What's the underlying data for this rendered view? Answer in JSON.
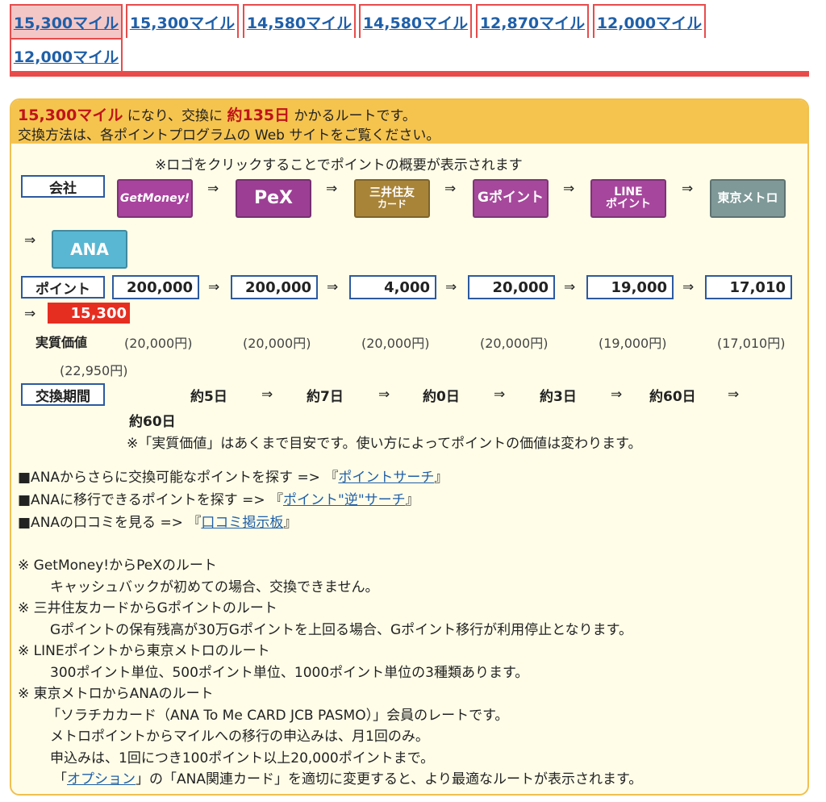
{
  "tabs": [
    {
      "label": "15,300マイル",
      "active": true
    },
    {
      "label": "15,300マイル"
    },
    {
      "label": "14,580マイル"
    },
    {
      "label": "14,580マイル"
    },
    {
      "label": "12,870マイル"
    },
    {
      "label": "12,000マイル"
    },
    {
      "label": "12,000マイル"
    }
  ],
  "header": {
    "miles": "15,300マイル",
    "text1": "になり、交換に",
    "days": "約135日",
    "text2": "かかるルートです。",
    "line2": "交換方法は、各ポイントプログラムの Web サイトをご覧ください。"
  },
  "logo_note": "※ロゴをクリックすることでポイントの概要が表示されます",
  "labels": {
    "company": "会社",
    "points": "ポイント",
    "value": "実質価値",
    "period": "交換期間"
  },
  "arrow": "⇒",
  "logos": [
    {
      "name": "GetMoney!",
      "l1": "GetMoney!",
      "l2": ""
    },
    {
      "name": "PeX",
      "l1": "PeX",
      "l2": ""
    },
    {
      "name": "三井住友カード",
      "l1": "三井住友",
      "l2": "カード"
    },
    {
      "name": "Gポイント",
      "l1": "Gポイント",
      "l2": ""
    },
    {
      "name": "LINEポイント",
      "l1": "LINE",
      "l2": "ポイント"
    },
    {
      "name": "東京メトロ",
      "l1": "東京メトロ",
      "l2": ""
    },
    {
      "name": "ANA",
      "l1": "ANA",
      "l2": ""
    }
  ],
  "points": [
    "200,000",
    "200,000",
    "4,000",
    "20,000",
    "19,000",
    "17,010"
  ],
  "final_points": "15,300",
  "values": [
    "(20,000円)",
    "(20,000円)",
    "(20,000円)",
    "(20,000円)",
    "(19,000円)",
    "(17,010円)",
    "(22,950円)"
  ],
  "periods": [
    "約5日",
    "約7日",
    "約0日",
    "約3日",
    "約60日",
    "約60日"
  ],
  "value_note": "※「実質価値」はあくまで目安です。使い方によってポイントの価値は変わります。",
  "search_links": [
    {
      "prefix": "■ANAからさらに交換可能なポイントを探す => 『",
      "link": "ポイントサーチ",
      "suffix": "』"
    },
    {
      "prefix": "■ANAに移行できるポイントを探す => 『",
      "link": "ポイント\"逆\"サーチ",
      "suffix": "』"
    },
    {
      "prefix": "■ANAの口コミを見る => 『",
      "link": "口コミ掲示板",
      "suffix": "』"
    }
  ],
  "notes": [
    {
      "title": "※ GetMoney!からPeXのルート",
      "lines": [
        "キャッシュバックが初めての場合、交換できません。"
      ]
    },
    {
      "title": "※ 三井住友カードからGポイントのルート",
      "lines": [
        "Gポイントの保有残高が30万Gポイントを上回る場合、Gポイント移行が利用停止となります。"
      ]
    },
    {
      "title": "※ LINEポイントから東京メトロのルート",
      "lines": [
        "300ポイント単位、500ポイント単位、1000ポイント単位の3種類あります。"
      ]
    },
    {
      "title": "※ 東京メトロからANAのルート",
      "lines": [
        "「ソラチカカード（ANA To Me CARD JCB PASMO）」会員のレートです。",
        "メトロポイントからマイルへの移行の申込みは、月1回のみ。",
        "申込みは、1回につき100ポイント以上20,000ポイントまで。"
      ]
    }
  ],
  "option_line": {
    "prefix": "「",
    "link": "オプション",
    "suffix": "」の「ANA関連カード」を適切に変更すると、より最適なルートが表示されます。"
  }
}
